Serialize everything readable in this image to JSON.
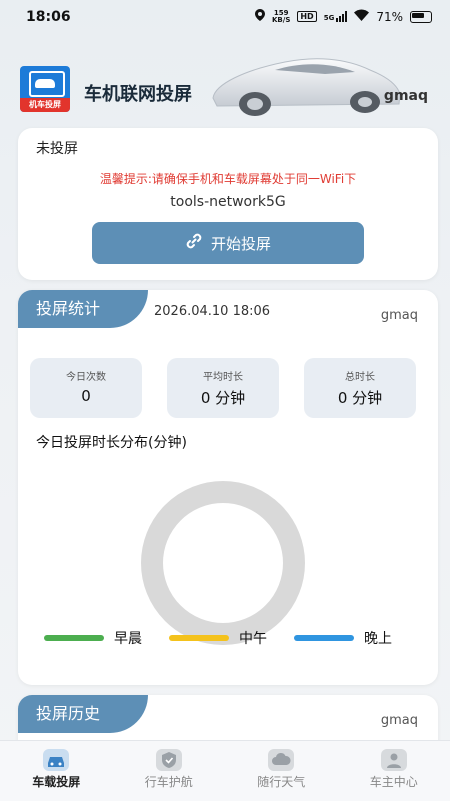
{
  "status_bar": {
    "time": "18:06",
    "speed_value": "159",
    "speed_unit": "KB/S",
    "hd": "HD",
    "network": "5G",
    "battery": "71%"
  },
  "header": {
    "logo_text": "机车投屏",
    "title": "车机联网投屏",
    "username": "gmaq"
  },
  "connection_card": {
    "status": "未投屏",
    "tip": "温馨提示:请确保手机和车载屏幕处于同一WiFi下",
    "network_name": "tools-network5G",
    "button_label": "开始投屏"
  },
  "stats_card": {
    "title": "投屏统计",
    "datetime": "2026.04.10 18:06",
    "username": "gmaq",
    "stats": [
      {
        "label": "今日次数",
        "value": "0"
      },
      {
        "label": "平均时长",
        "value": "0 分钟"
      },
      {
        "label": "总时长",
        "value": "0 分钟"
      }
    ],
    "distribution_title": "今日投屏时长分布(分钟)",
    "legend": [
      {
        "label": "早晨",
        "color": "#4cae4f"
      },
      {
        "label": "中午",
        "color": "#f4c21c"
      },
      {
        "label": "晚上",
        "color": "#2f95e0"
      }
    ],
    "donut_empty_color": "#d9d9d9"
  },
  "history_card": {
    "title": "投屏历史",
    "username": "gmaq"
  },
  "bottom_nav": [
    {
      "label": "车载投屏",
      "icon": "car-icon",
      "active": true
    },
    {
      "label": "行车护航",
      "icon": "shield-icon",
      "active": false
    },
    {
      "label": "随行天气",
      "icon": "cloud-icon",
      "active": false
    },
    {
      "label": "车主中心",
      "icon": "user-icon",
      "active": false
    }
  ]
}
